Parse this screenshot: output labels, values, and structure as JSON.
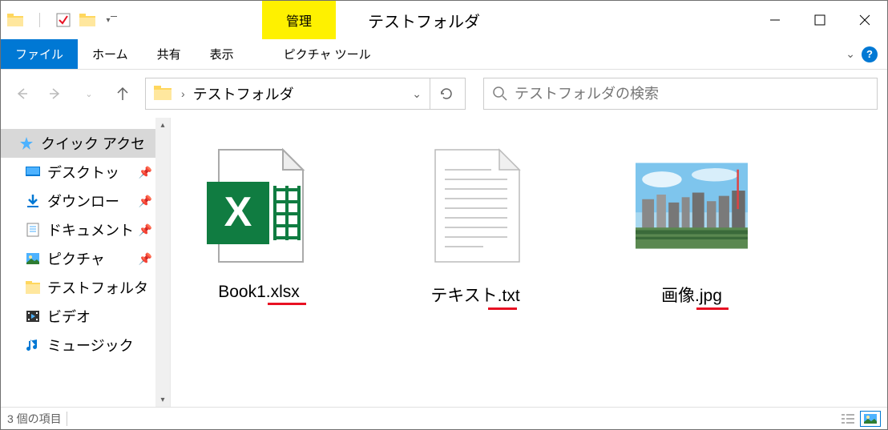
{
  "title_tab": "管理",
  "window_title": "テストフォルダ",
  "ribbon": {
    "file": "ファイル",
    "home": "ホーム",
    "share": "共有",
    "view": "表示",
    "picture_tools": "ピクチャ ツール"
  },
  "address": {
    "path": "テストフォルダ"
  },
  "search": {
    "placeholder": "テストフォルダの検索"
  },
  "sidebar": {
    "quick_access": "クイック アクセ",
    "desktop": "デスクトッ",
    "downloads": "ダウンロー",
    "documents": "ドキュメント",
    "pictures": "ピクチャ",
    "test_folder": "テストフォルタ",
    "videos": "ビデオ",
    "music": "ミュージック"
  },
  "files": [
    {
      "name": "Book1.xlsx",
      "type": "xlsx"
    },
    {
      "name": "テキスト.txt",
      "type": "txt"
    },
    {
      "name": "画像.jpg",
      "type": "jpg"
    }
  ],
  "status": {
    "count": "3 個の項目"
  }
}
